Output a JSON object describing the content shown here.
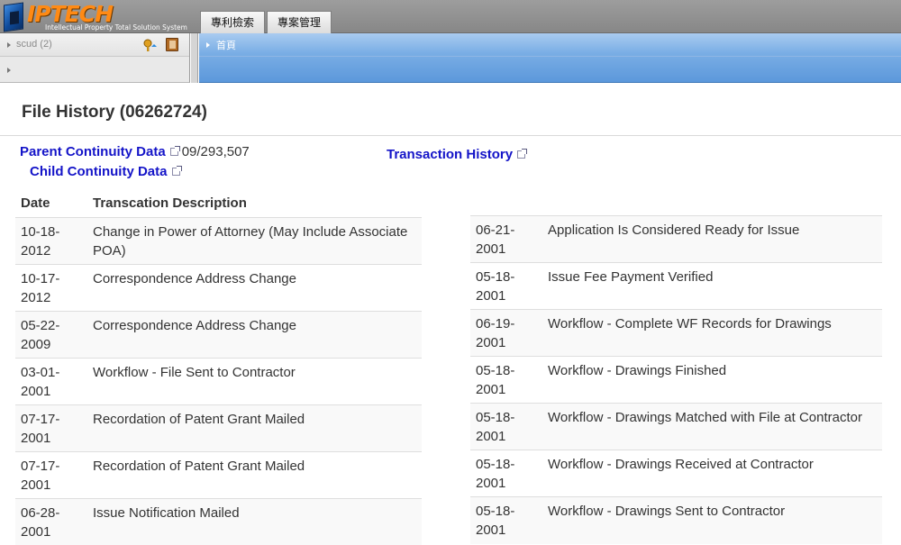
{
  "header": {
    "logo_text": "IPTECH",
    "logo_subtitle": "Intellectual Property Total Solution System",
    "tabs": [
      "專利檢索",
      "專案管理"
    ]
  },
  "sidebar": {
    "user_label": "scud (2)"
  },
  "workspace_tabs": {
    "home": "首頁"
  },
  "page": {
    "title": "File History (06262724)",
    "parent_link": "Parent Continuity Data",
    "parent_number": "09/293,507",
    "child_link": "Child Continuity Data",
    "transaction_link": "Transaction History"
  },
  "table": {
    "headers": [
      "Date",
      "Transcation Description"
    ],
    "left_rows": [
      {
        "date": "10-18-2012",
        "desc": "Change in Power of Attorney (May Include Associate POA)"
      },
      {
        "date": "10-17-2012",
        "desc": "Correspondence Address Change"
      },
      {
        "date": "05-22-2009",
        "desc": "Correspondence Address Change"
      },
      {
        "date": "03-01-2001",
        "desc": "Workflow - File Sent to Contractor"
      },
      {
        "date": "07-17-2001",
        "desc": "Recordation of Patent Grant Mailed"
      },
      {
        "date": "07-17-2001",
        "desc": "Recordation of Patent Grant Mailed"
      },
      {
        "date": "06-28-2001",
        "desc": "Issue Notification Mailed"
      }
    ],
    "right_rows": [
      {
        "date": "06-21-2001",
        "desc": "Application Is Considered Ready for Issue"
      },
      {
        "date": "05-18-2001",
        "desc": "Issue Fee Payment Verified"
      },
      {
        "date": "06-19-2001",
        "desc": "Workflow - Complete WF Records for Drawings"
      },
      {
        "date": "05-18-2001",
        "desc": "Workflow - Drawings Finished"
      },
      {
        "date": "05-18-2001",
        "desc": "Workflow - Drawings Matched with File at Contractor"
      },
      {
        "date": "05-18-2001",
        "desc": "Workflow - Drawings Received at Contractor"
      },
      {
        "date": "05-18-2001",
        "desc": "Workflow - Drawings Sent to Contractor"
      }
    ]
  },
  "colors": {
    "link": "#1414c8",
    "logo_orange": "#ff8a14",
    "tab_strip_blue": "#7aaee5"
  }
}
